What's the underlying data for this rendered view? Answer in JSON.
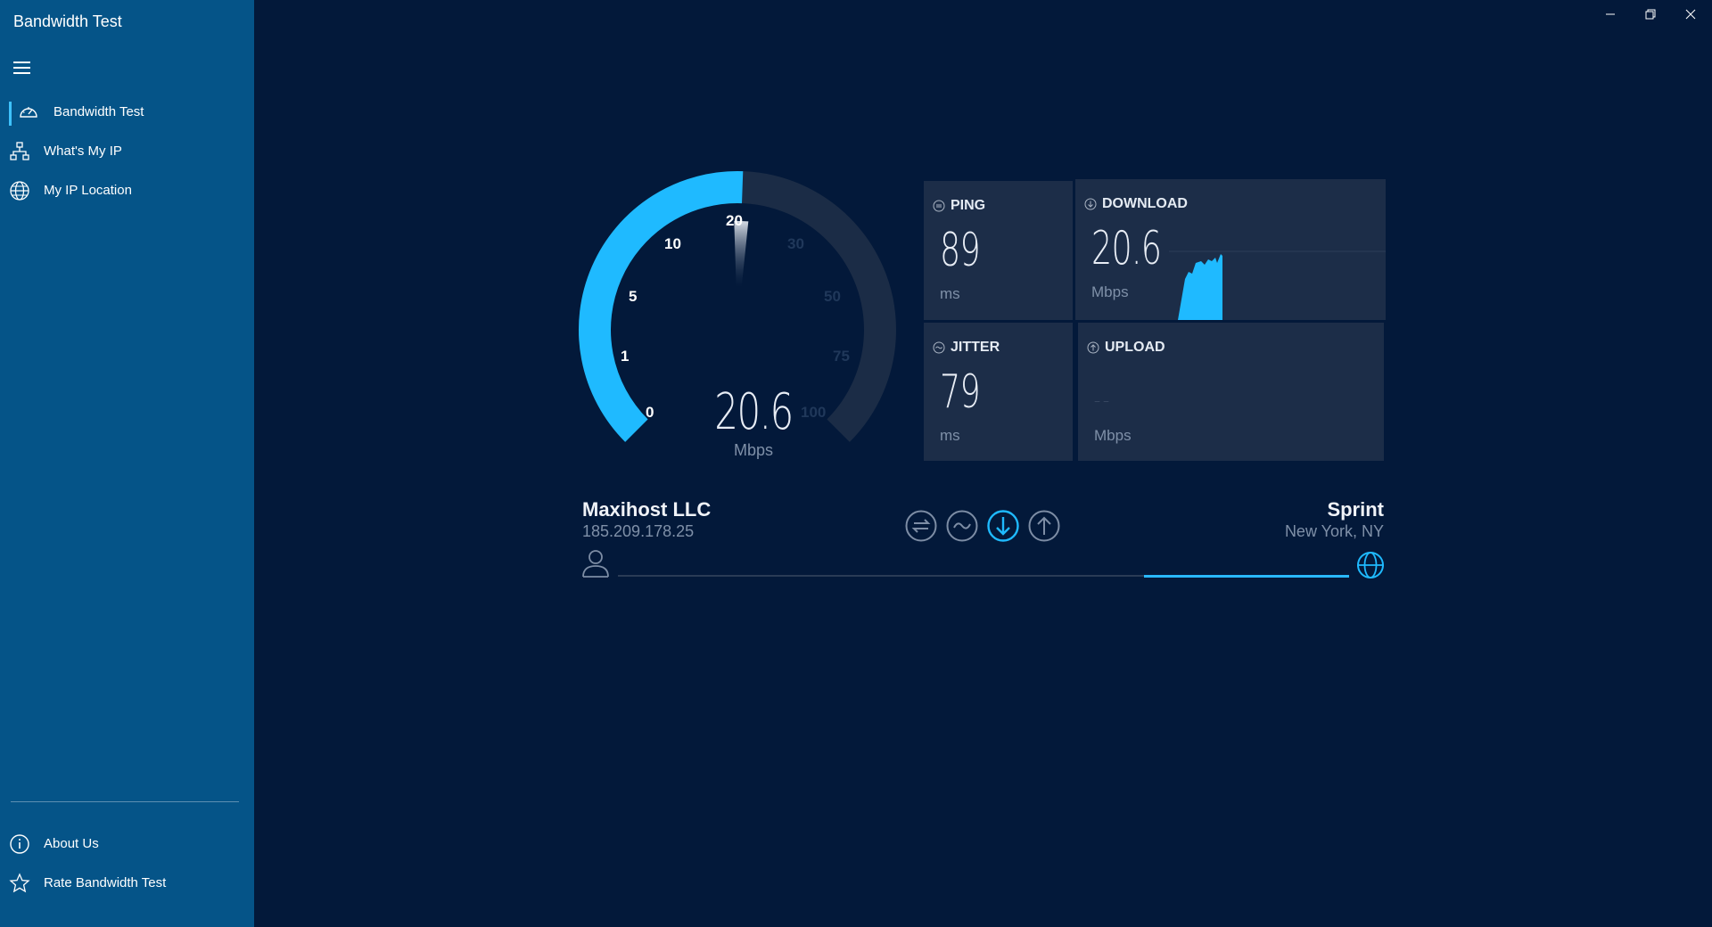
{
  "app": {
    "title": "Bandwidth Test"
  },
  "sidebar": {
    "items": [
      {
        "label": "Bandwidth Test",
        "icon": "speedometer-icon",
        "active": true
      },
      {
        "label": "What's My IP",
        "icon": "network-icon",
        "active": false
      },
      {
        "label": "My IP Location",
        "icon": "globe-icon",
        "active": false
      }
    ],
    "footer": [
      {
        "label": "About Us",
        "icon": "info-icon"
      },
      {
        "label": "Rate Bandwidth Test",
        "icon": "star-icon"
      }
    ]
  },
  "gauge": {
    "value": "20.6",
    "unit": "Mbps",
    "ticks": [
      "0",
      "1",
      "5",
      "10",
      "20",
      "30",
      "50",
      "75",
      "100"
    ],
    "level": 20.6
  },
  "metrics": {
    "ping": {
      "title": "PING",
      "value": "89",
      "unit": "ms"
    },
    "download": {
      "title": "DOWNLOAD",
      "value": "20.6",
      "unit": "Mbps"
    },
    "jitter": {
      "title": "JITTER",
      "value": "79",
      "unit": "ms"
    },
    "upload": {
      "title": "UPLOAD",
      "value": "– –",
      "unit": "Mbps"
    }
  },
  "connection": {
    "isp": "Maxihost LLC",
    "ip": "185.209.178.25",
    "server": "Sprint",
    "location": "New York, NY",
    "progress": 0.28
  },
  "steps": [
    {
      "name": "ping-step-icon",
      "active": false
    },
    {
      "name": "jitter-step-icon",
      "active": false
    },
    {
      "name": "download-step-icon",
      "active": true
    },
    {
      "name": "upload-step-icon",
      "active": false
    }
  ],
  "colors": {
    "background": "#03193a",
    "sidebar": "#055488",
    "accent": "#1fbaff",
    "panel": "#1c2d48"
  }
}
